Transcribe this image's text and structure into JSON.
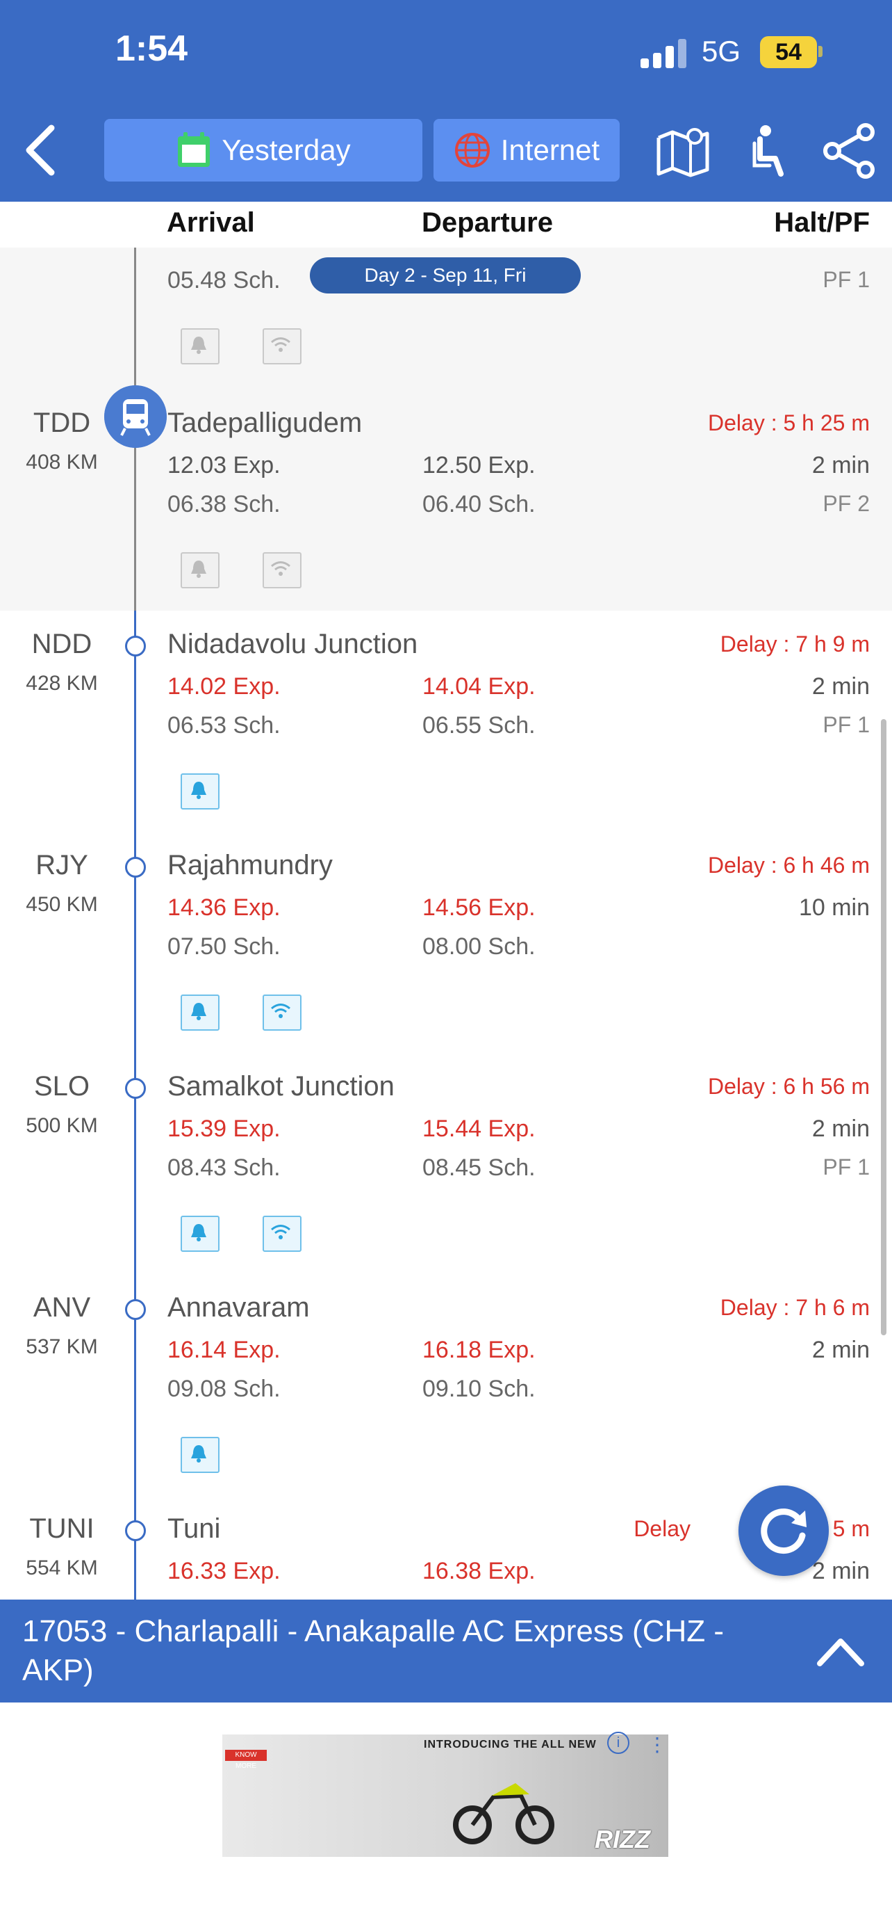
{
  "status": {
    "time": "1:54",
    "network": "5G",
    "battery": "54"
  },
  "header": {
    "day_button": "Yesterday",
    "source_button": "Internet",
    "icons": [
      "back-chevron-icon",
      "calendar-icon",
      "globe-icon",
      "map-icon",
      "seat-icon",
      "share-icon"
    ]
  },
  "columns": {
    "arrival": "Arrival",
    "departure": "Departure",
    "halt_pf": "Halt/PF"
  },
  "day_banner": "Day 2 - Sep 11, Fri",
  "previous_stop_partial": {
    "arrival_sch": "05.48 Sch.",
    "platform": "PF 1"
  },
  "stations": [
    {
      "code": "TDD",
      "km": "408 KM",
      "name": "Tadepalligudem",
      "delay": "Delay : 5 h  25 m",
      "arr_exp": "12.03 Exp.",
      "dep_exp": "12.50 Exp.",
      "arr_sch": "06.38 Sch.",
      "dep_sch": "06.40 Sch.",
      "halt": "2 min",
      "platform": "PF 2",
      "current": true
    },
    {
      "code": "NDD",
      "km": "428 KM",
      "name": "Nidadavolu Junction",
      "delay": "Delay : 7 h  9 m",
      "arr_exp": "14.02 Exp.",
      "dep_exp": "14.04 Exp.",
      "arr_sch": "06.53 Sch.",
      "dep_sch": "06.55 Sch.",
      "halt": "2 min",
      "platform": "PF 1"
    },
    {
      "code": "RJY",
      "km": "450 KM",
      "name": "Rajahmundry",
      "delay": "Delay : 6 h  46 m",
      "arr_exp": "14.36 Exp.",
      "dep_exp": "14.56 Exp.",
      "arr_sch": "07.50 Sch.",
      "dep_sch": "08.00 Sch.",
      "halt": "10 min",
      "platform": ""
    },
    {
      "code": "SLO",
      "km": "500 KM",
      "name": "Samalkot Junction",
      "delay": "Delay : 6 h  56 m",
      "arr_exp": "15.39 Exp.",
      "dep_exp": "15.44 Exp.",
      "arr_sch": "08.43 Sch.",
      "dep_sch": "08.45 Sch.",
      "halt": "2 min",
      "platform": "PF 1"
    },
    {
      "code": "ANV",
      "km": "537 KM",
      "name": "Annavaram",
      "delay": "Delay : 7 h  6 m",
      "arr_exp": "16.14 Exp.",
      "dep_exp": "16.18 Exp.",
      "arr_sch": "09.08 Sch.",
      "dep_sch": "09.10 Sch.",
      "halt": "2 min",
      "platform": ""
    },
    {
      "code": "TUNI",
      "km": "554 KM",
      "name": "Tuni",
      "delay": "Delay",
      "delay_tail": "5 m",
      "arr_exp": "16.33 Exp.",
      "dep_exp": "16.38 Exp.",
      "halt": "2 min"
    }
  ],
  "train_title": "17053 - Charlapalli - Anakapalle AC Express (CHZ - AKP)",
  "ad": {
    "headline": "INTRODUCING THE ALL NEW",
    "brand": "RIZZ",
    "cta": "KNOW MORE",
    "info": "i"
  }
}
